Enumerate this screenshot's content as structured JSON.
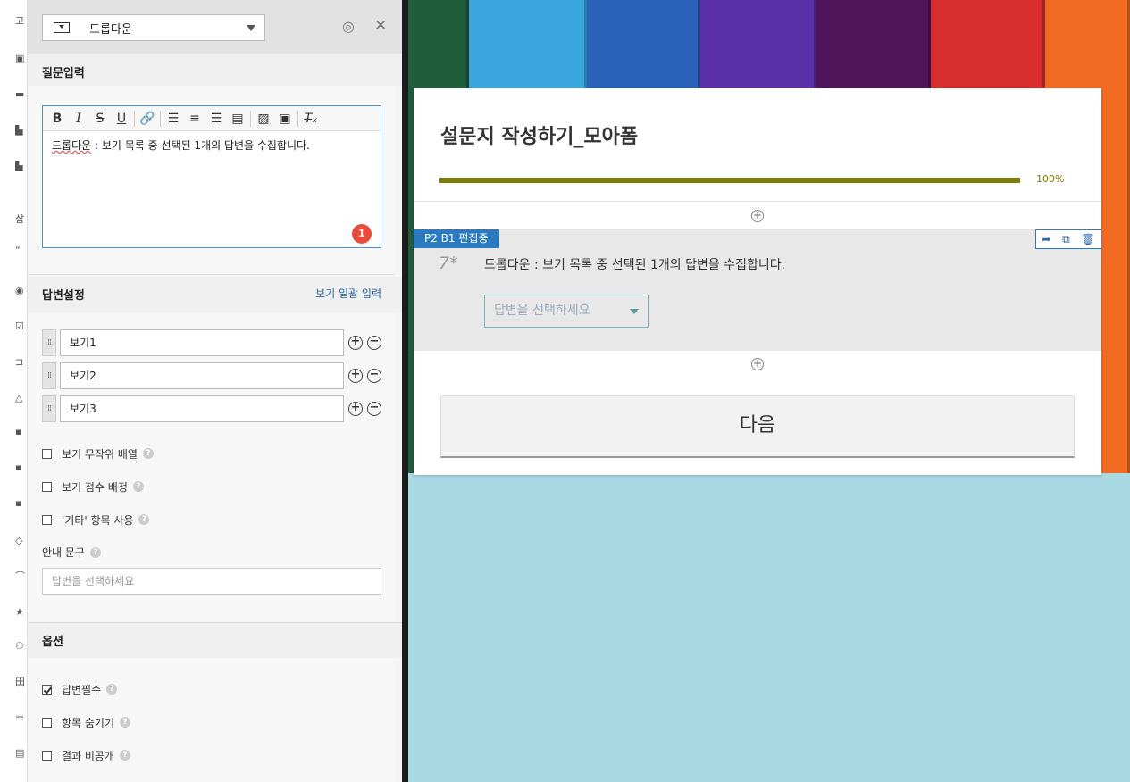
{
  "colors": {
    "crayons": [
      "#1f5e3b",
      "#3aa8df",
      "#2b63b8",
      "#5b2fa8",
      "#51135a",
      "#d62e2e",
      "#f06a21"
    ],
    "progress": "#7d7d0a",
    "edit_tag": "#2a7ac2",
    "badge": "#e74c3c"
  },
  "panel": {
    "type_select": {
      "value": "드롭다운",
      "icon": "dropdown-icon"
    },
    "question_section": "질문입력",
    "editor": {
      "toolbar": [
        "B",
        "I",
        "S",
        "U",
        "link",
        "align-left",
        "align-center",
        "align-right",
        "justify",
        "image",
        "video",
        "clear-format"
      ],
      "text_marked": "드롭다운",
      "text_rest": " : 보기 목록 중 선택된 1개의 답변을 수집합니다.",
      "badge": "1"
    },
    "answer_section": "답변설정",
    "bulk_input": "보기 일괄 입력",
    "choices": [
      "보기1",
      "보기2",
      "보기3"
    ],
    "checks": [
      {
        "label": "보기 무작위 배열",
        "checked": false
      },
      {
        "label": "보기 점수 배정",
        "checked": false
      },
      {
        "label": "'기타' 항목 사용",
        "checked": false
      }
    ],
    "guide_label": "안내 문구",
    "guide_placeholder": "답변을 선택하세요",
    "options_section": "옵션",
    "options": [
      {
        "label": "답변필수",
        "checked": true
      },
      {
        "label": "항목 숨기기",
        "checked": false
      },
      {
        "label": "결과 비공개",
        "checked": false
      }
    ]
  },
  "survey": {
    "title": "설문지 작성하기_모아폼",
    "progress_percent": 100,
    "progress_label": "100%",
    "edit_tag": "P2 B1 편집중",
    "question": {
      "number": "7*",
      "text": "드롭다운 : 보기 목록 중 선택된 1개의 답변을 수집합니다.",
      "select_placeholder": "답변을 선택하세요"
    },
    "next_button": "다음"
  }
}
